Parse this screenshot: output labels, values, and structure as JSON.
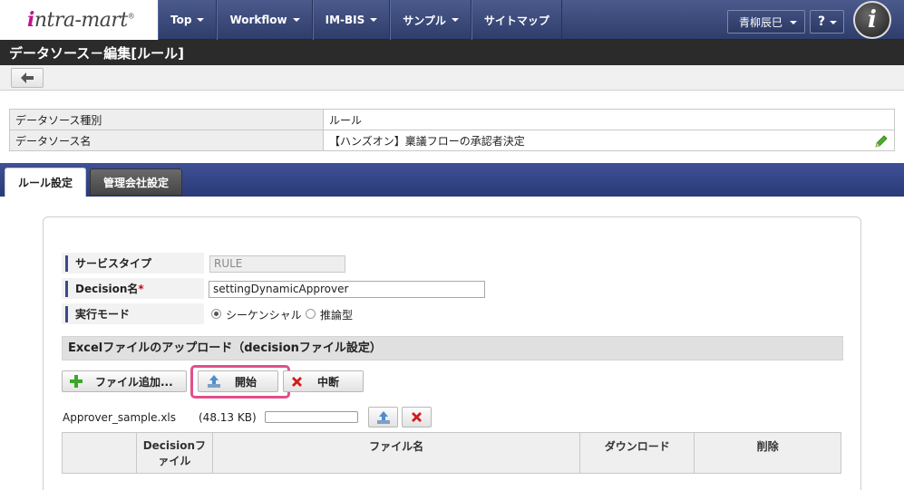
{
  "header": {
    "logo_text": "intra-mart",
    "nav": [
      {
        "label": "Top"
      },
      {
        "label": "Workflow"
      },
      {
        "label": "IM-BIS"
      },
      {
        "label": "サンプル"
      },
      {
        "label": "サイトマップ"
      }
    ],
    "user_name": "青柳辰巳",
    "help_label": "?",
    "brand_letter": "i"
  },
  "page_title": "データソース－編集[ルール]",
  "info": {
    "rows": [
      {
        "label": "データソース種別",
        "value": "ルール"
      },
      {
        "label": "データソース名",
        "value": "【ハンズオン】稟議フローの承認者決定"
      }
    ]
  },
  "tabs": [
    {
      "label": "ルール設定",
      "active": true
    },
    {
      "label": "管理会社設定",
      "active": false
    }
  ],
  "form": {
    "service_type_label": "サービスタイプ",
    "service_type_value": "RULE",
    "decision_label": "Decision名",
    "required_mark": "*",
    "decision_value": "settingDynamicApprover",
    "mode_label": "実行モード",
    "mode_options": [
      {
        "label": "シーケンシャル",
        "checked": true
      },
      {
        "label": "推論型",
        "checked": false
      }
    ]
  },
  "upload": {
    "section_title": "Excelファイルのアップロード（decisionファイル設定）",
    "add_button": "ファイル追加...",
    "start_button": "開始",
    "abort_button": "中断",
    "file_name": "Approver_sample.xls",
    "file_size": "(48.13 KB)",
    "progress": 0,
    "columns": [
      "",
      "Decisionファイル",
      "ファイル名",
      "ダウンロード",
      "削除"
    ]
  },
  "colors": {
    "nav_bg": "#2f3d6b",
    "title_bg": "#2b2b2b",
    "highlight": "#e0508a",
    "accent": "#3a4a8c"
  }
}
